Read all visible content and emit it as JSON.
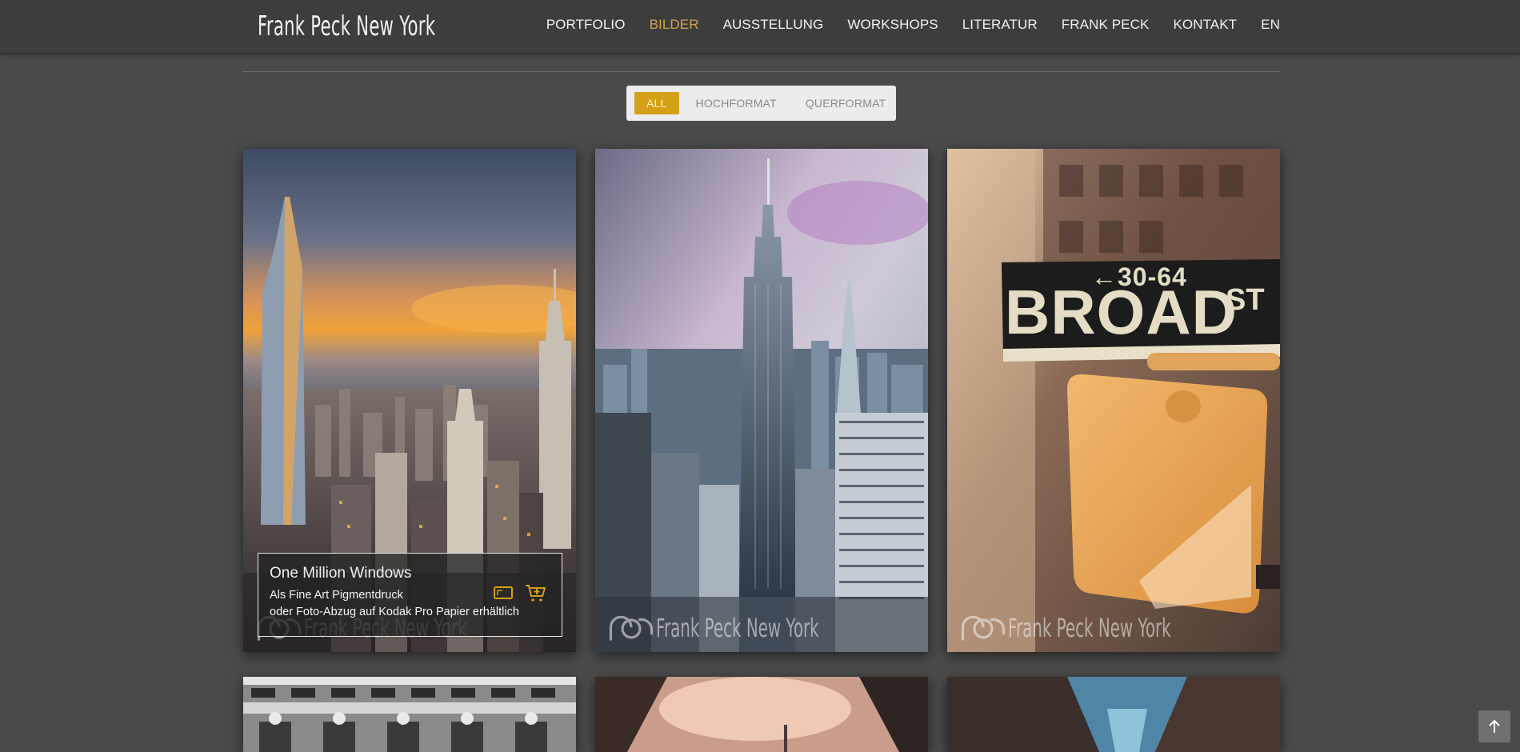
{
  "header": {
    "logo_text": "Frank Peck New York",
    "nav": [
      {
        "label": "PORTFOLIO",
        "active": false
      },
      {
        "label": "BILDER",
        "active": true
      },
      {
        "label": "AUSSTELLUNG",
        "active": false
      },
      {
        "label": "WORKSHOPS",
        "active": false
      },
      {
        "label": "LITERATUR",
        "active": false
      },
      {
        "label": "FRANK PECK",
        "active": false
      },
      {
        "label": "KONTAKT",
        "active": false
      },
      {
        "label": "EN",
        "active": false
      }
    ]
  },
  "filter": {
    "options": [
      {
        "label": "ALL",
        "active": true
      },
      {
        "label": "HOCHFORMAT",
        "active": false
      },
      {
        "label": "QUERFORMAT",
        "active": false
      }
    ]
  },
  "gallery": {
    "watermark": "Frank Peck New York",
    "featured_caption": {
      "title": "One Million Windows",
      "line1": "Als Fine Art Pigmentdruck",
      "line2": "oder Foto-Abzug auf Kodak Pro Papier erhältlich",
      "icons": [
        "frame-icon",
        "cart-add-icon"
      ]
    },
    "broad_sign": {
      "arrow_text": "←30-64",
      "main_text": "BROAD",
      "suffix": "ST"
    }
  },
  "colors": {
    "accent": "#d4a017",
    "background": "#4a4a4a",
    "header": "#3d3d3d"
  },
  "icons": {
    "back_to_top": "arrow-up-icon"
  }
}
